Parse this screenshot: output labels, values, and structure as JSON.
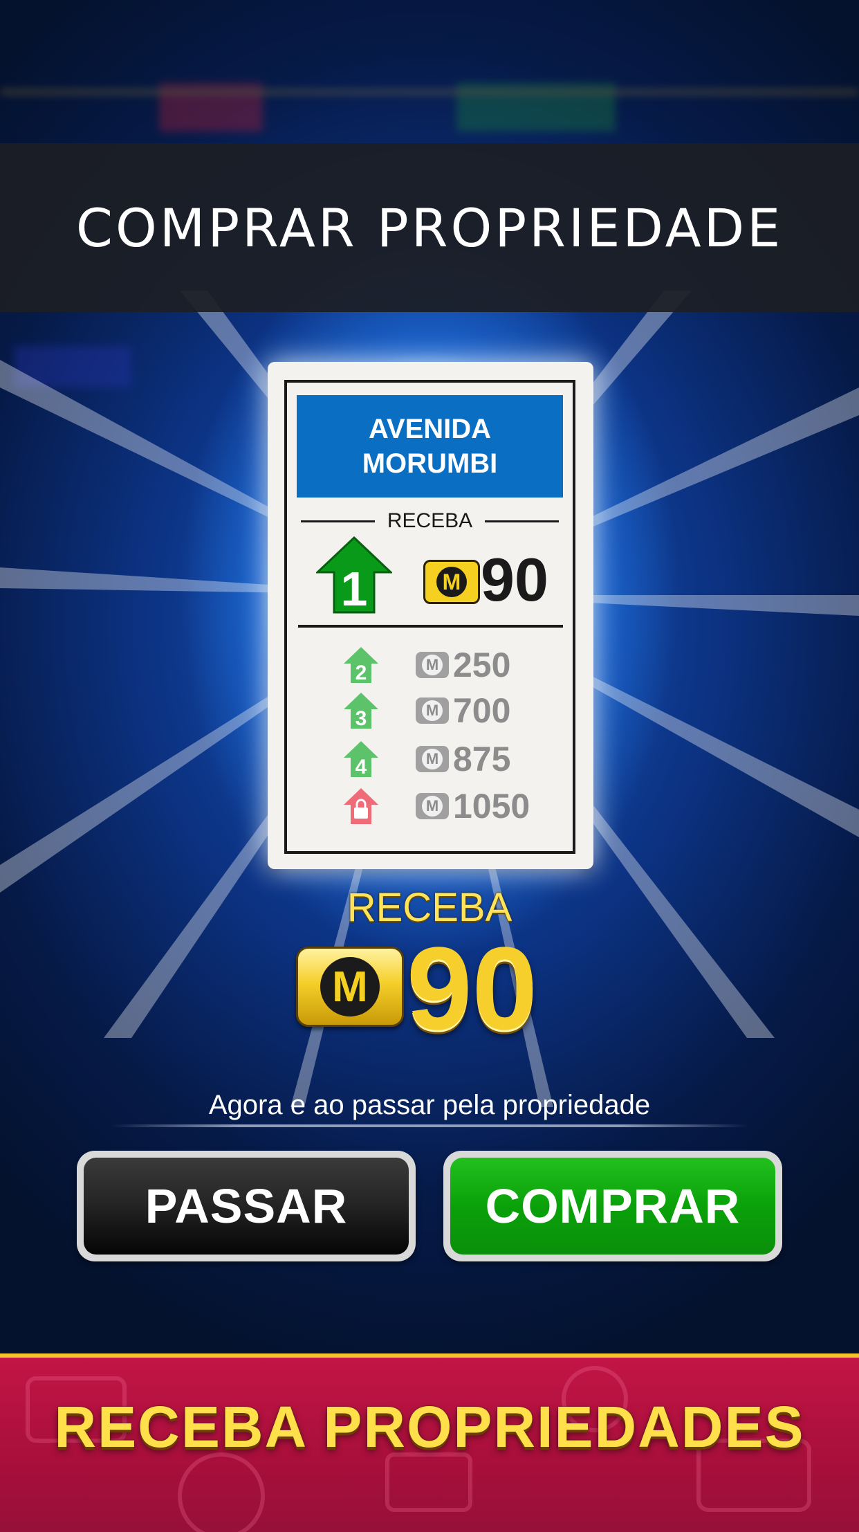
{
  "dialog": {
    "title": "COMPRAR PROPRIEDADE"
  },
  "card": {
    "name_line1": "AVENIDA",
    "name_line2": "MORUMBI",
    "header_color": "#0a6fc2",
    "receba_label": "RECEBA",
    "main_level": "1",
    "main_rent": "90",
    "upgrades": [
      {
        "level": "2",
        "rent": "250",
        "icon": "green-house-2-icon"
      },
      {
        "level": "3",
        "rent": "700",
        "icon": "green-house-3-icon"
      },
      {
        "level": "4",
        "rent": "875",
        "icon": "green-house-4-icon"
      },
      {
        "level": "",
        "rent": "1050",
        "icon": "red-lock-house-icon"
      }
    ]
  },
  "reward": {
    "label": "RECEBA",
    "amount": "90",
    "description": "Agora e ao passar pela propriedade"
  },
  "buttons": {
    "pass_label": "PASSAR",
    "buy_label": "COMPRAR"
  },
  "banner": {
    "text": "RECEBA PROPRIEDADES"
  },
  "colors": {
    "accent_green": "#0aa10a",
    "banner_red": "#b0123e",
    "gold": "#ffe04a"
  }
}
